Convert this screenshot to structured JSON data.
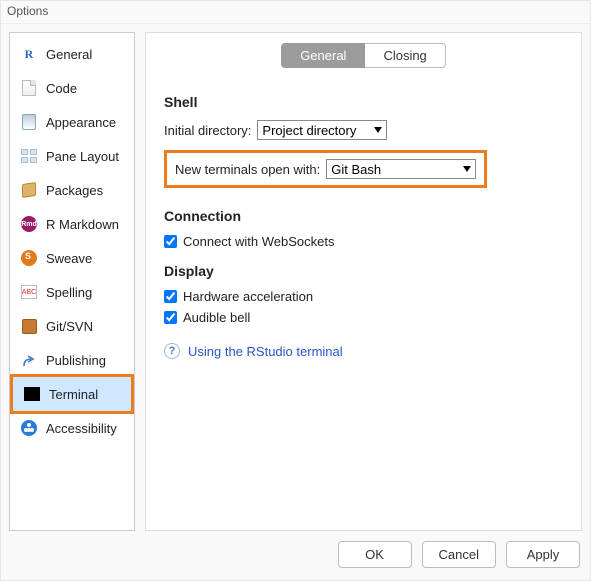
{
  "window": {
    "title": "Options"
  },
  "sidebar": {
    "items": [
      {
        "label": "General"
      },
      {
        "label": "Code"
      },
      {
        "label": "Appearance"
      },
      {
        "label": "Pane Layout"
      },
      {
        "label": "Packages"
      },
      {
        "label": "R Markdown"
      },
      {
        "label": "Sweave"
      },
      {
        "label": "Spelling"
      },
      {
        "label": "Git/SVN"
      },
      {
        "label": "Publishing"
      },
      {
        "label": "Terminal"
      },
      {
        "label": "Accessibility"
      }
    ],
    "selected_index": 10
  },
  "tabs": [
    {
      "label": "General",
      "active": true
    },
    {
      "label": "Closing",
      "active": false
    }
  ],
  "sections": {
    "shell": {
      "title": "Shell",
      "initial_dir": {
        "label": "Initial directory:",
        "value": "Project directory"
      },
      "new_terminal": {
        "label": "New terminals open with:",
        "value": "Git Bash"
      }
    },
    "connection": {
      "title": "Connection",
      "websockets": {
        "checked": true,
        "label": "Connect with WebSockets"
      }
    },
    "display": {
      "title": "Display",
      "hw_accel": {
        "checked": true,
        "label": "Hardware acceleration"
      },
      "audible_bell": {
        "checked": true,
        "label": "Audible bell"
      }
    }
  },
  "help_link": {
    "text": "Using the RStudio terminal"
  },
  "buttons": {
    "ok": "OK",
    "cancel": "Cancel",
    "apply": "Apply"
  },
  "colors": {
    "highlight": "#ec7c1c",
    "link": "#2a55c6",
    "selection": "#cfe8ff"
  },
  "icons": {
    "rmd_badge": "Rmd",
    "spelling_badge": "ABC"
  }
}
